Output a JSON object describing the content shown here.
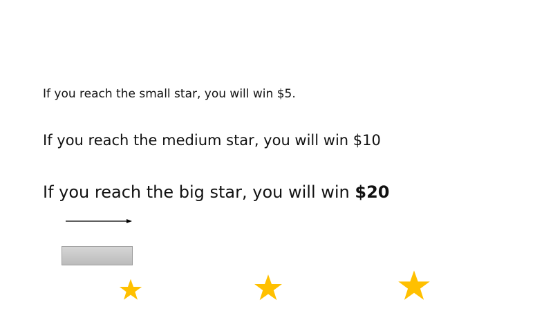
{
  "instructions": {
    "small": "If you reach the small star, you will win $5.",
    "medium": "If you reach the medium star, you will win $10",
    "big_prefix": "If you reach the big star, you will win ",
    "big_amount": "$20"
  },
  "icons": {
    "arrow": "right-arrow-icon",
    "progress": "progress-bar",
    "stars": [
      "small-star-icon",
      "medium-star-icon",
      "big-star-icon"
    ]
  },
  "colors": {
    "star": "#FFC000",
    "text": "#111111",
    "progress_fill": "#C8C8C8",
    "progress_border": "#9A9A9A"
  }
}
